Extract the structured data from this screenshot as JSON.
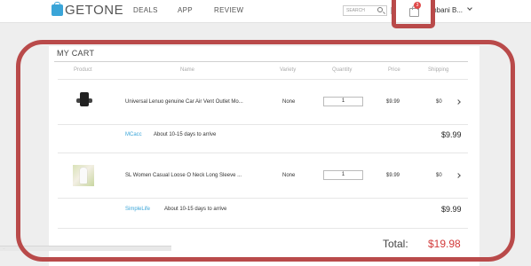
{
  "header": {
    "logo_text": "GETONE",
    "nav": [
      "DEALS",
      "APP",
      "REVIEW"
    ],
    "search_placeholder": "SEARCH",
    "cart_count": "3",
    "user_name": "mbani B..."
  },
  "cart": {
    "title": "MY CART",
    "columns": [
      "Product",
      "Name",
      "Variety",
      "Quantity",
      "Price",
      "Shipping"
    ],
    "items": [
      {
        "name": "Universal Lenuo genuine Car Air Vent Outlet Mo...",
        "variety": "None",
        "quantity": "1",
        "price": "$9.99",
        "shipping": "$0",
        "seller": "MCacc",
        "arrival": "About 10-15 days to arrive",
        "subtotal": "$9.99"
      },
      {
        "name": "SL Women Casual Loose O Neck Long Sleeve ...",
        "variety": "None",
        "quantity": "1",
        "price": "$9.99",
        "shipping": "$0",
        "seller": "SimpleLife",
        "arrival": "About 10-15 days to arrive",
        "subtotal": "$9.99"
      }
    ],
    "total_label": "Total:",
    "total_value": "$19.98"
  },
  "status_text": "...",
  "colors": {
    "accent": "#3aa5d8",
    "highlight": "#b94a4a",
    "total": "#d23a3a",
    "badge": "#e04a4a"
  }
}
